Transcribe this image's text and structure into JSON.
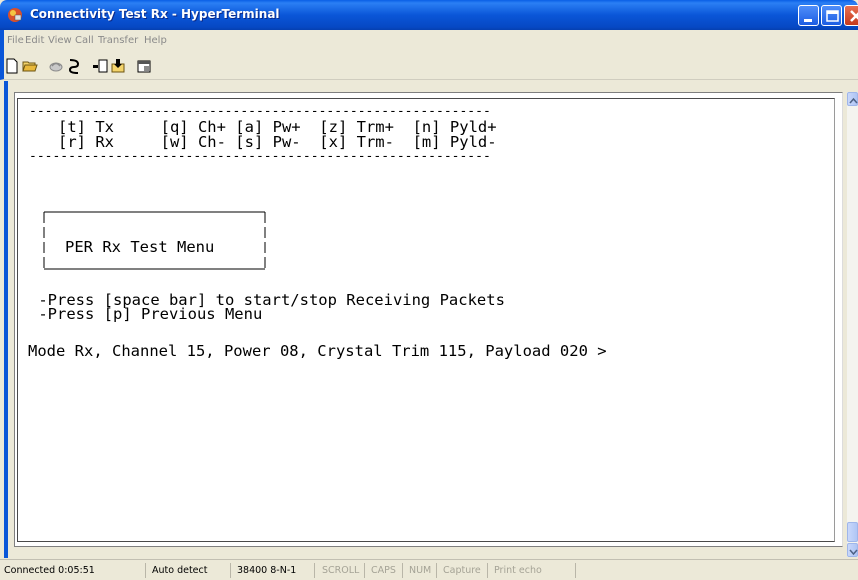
{
  "window": {
    "title": "Connectivity Test Rx - HyperTerminal"
  },
  "menu": {
    "items": [
      "File",
      "Edit",
      "View",
      "Call",
      "Transfer",
      "Help"
    ]
  },
  "toolbar": {
    "icons": [
      "new-icon",
      "open-icon",
      "disconnect-icon",
      "call-icon",
      "send-icon",
      "receive-icon",
      "properties-icon"
    ]
  },
  "terminal": {
    "lines": [
      "-----------------------------------------------------------",
      "   [t] Tx     [q] Ch+ [a] Pw+  [z] Trm+  [n] Pyld+",
      "   [r] Rx     [w] Ch- [s] Pw-  [x] Trm-  [m] Pyld-",
      "-----------------------------------------------------------",
      "PER Rx Test Menu",
      " -Press [space bar] to start/stop Receiving Packets",
      " -Press [p] Previous Menu",
      "Mode Rx, Channel 15, Power 08, Crystal Trim 115, Payload 020 >"
    ]
  },
  "status": {
    "connected": "Connected 0:05:51",
    "detect": "Auto detect",
    "settings": "38400 8-N-1",
    "scroll": "SCROLL",
    "caps": "CAPS",
    "num": "NUM",
    "capture": "Capture",
    "print_echo": "Print echo"
  },
  "colors": {
    "titlebar": "#0a56d8",
    "chrome": "#ece9d8",
    "terminal_bg": "#ffffff",
    "terminal_text": "#000000"
  }
}
